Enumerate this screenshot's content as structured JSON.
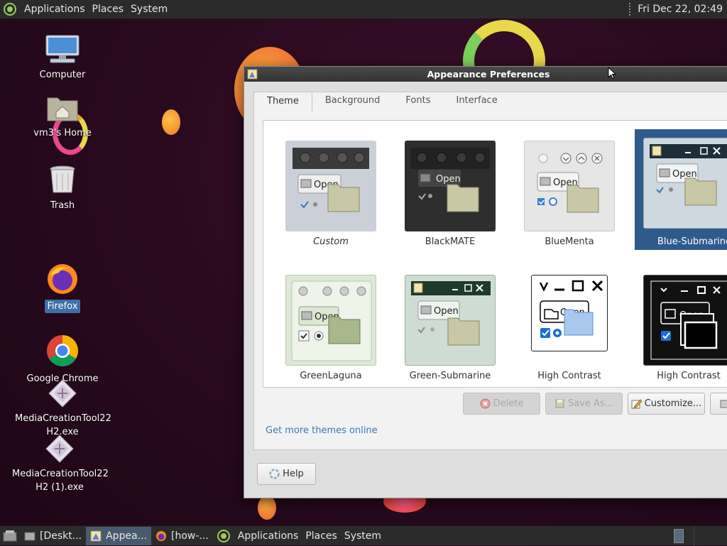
{
  "top_panel": {
    "menus": [
      "Applications",
      "Places",
      "System"
    ],
    "clock": "Fri Dec 22, 02:49"
  },
  "desktop_icons": [
    {
      "label": "Computer",
      "icon": "computer-icon"
    },
    {
      "label": "vm3's Home",
      "icon": "home-folder-icon"
    },
    {
      "label": "Trash",
      "icon": "trash-icon"
    },
    {
      "label": "Firefox",
      "icon": "firefox-icon",
      "selected": true
    },
    {
      "label": "Google Chrome",
      "icon": "chrome-icon"
    },
    {
      "label": "MediaCreationTool22H2.exe",
      "line1": "MediaCreationTool22",
      "line2": "H2.exe",
      "icon": "exe-file-icon"
    },
    {
      "label": "MediaCreationTool22H2 (1).exe",
      "line1": "MediaCreationTool22",
      "line2": "H2 (1).exe",
      "icon": "exe-file-icon"
    }
  ],
  "window": {
    "title": "Appearance Preferences",
    "tabs": [
      "Theme",
      "Background",
      "Fonts",
      "Interface"
    ],
    "active_tab": "Theme",
    "themes": [
      {
        "name": "Custom",
        "italic": true
      },
      {
        "name": "BlackMATE"
      },
      {
        "name": "BlueMenta"
      },
      {
        "name": "Blue-Submarine",
        "selected": true
      },
      {
        "name": "GreenLaguna"
      },
      {
        "name": "Green-Submarine"
      },
      {
        "name": "High Contrast"
      },
      {
        "name": "High Contrast"
      }
    ],
    "thumb_open_label": "Open",
    "buttons": {
      "delete": "Delete",
      "save_as": "Save As...",
      "customize": "Customize...",
      "help": "Help"
    },
    "more_themes_link": "Get more themes online"
  },
  "bottom_panel": {
    "tasks": [
      {
        "label": "[Deskt...",
        "icon": "desktop-icon"
      },
      {
        "label": "Appea...",
        "icon": "appearance-icon",
        "active": true
      },
      {
        "label": "[how-...",
        "icon": "firefox-icon"
      }
    ],
    "menus": [
      "Applications",
      "Places",
      "System"
    ]
  },
  "colors": {
    "accent": "#2f5a8c",
    "panel": "#2b2b2b",
    "link": "#3a78b5"
  }
}
